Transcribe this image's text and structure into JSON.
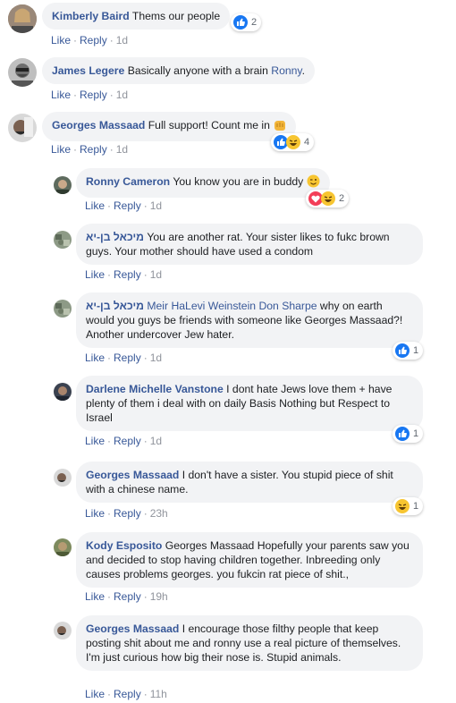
{
  "actions": {
    "like": "Like",
    "reply": "Reply",
    "sep": "·"
  },
  "comments": [
    {
      "author": "Kimberly Baird",
      "text": "Thems our people",
      "time": "1d",
      "reactions": {
        "icons": [
          "like"
        ],
        "count": "2"
      }
    },
    {
      "author": "James Legere",
      "text": "Basically anyone with a brain ",
      "mention": "Ronny",
      "after": ".",
      "time": "1d"
    },
    {
      "author": "Georges Massaad",
      "text": "Full support! Count me in ",
      "time": "1d",
      "reactions": {
        "icons": [
          "like",
          "haha"
        ],
        "count": "4"
      }
    },
    {
      "author": "Ronny Cameron",
      "text": "You know you are in buddy ",
      "time": "1d",
      "reactions": {
        "icons": [
          "love",
          "haha"
        ],
        "count": "2"
      }
    },
    {
      "author": "מיכאל בן-יא",
      "text": "You are another rat. Your sister likes to fukc brown guys. Your mother should have used a condom",
      "time": "1d"
    },
    {
      "author": "מיכאל בן-יא",
      "mention": "Meir HaLevi Weinstein Don Sharpe",
      "text": " why on earth would you guys be friends with someone like Georges Massaad?! Another undercover Jew hater.",
      "time": "1d",
      "reactions": {
        "icons": [
          "like"
        ],
        "count": "1"
      }
    },
    {
      "author": "Darlene Michelle Vanstone",
      "text": "I dont hate Jews love them + have plenty of them i deal with on daily Basis Nothing but Respect to Israel",
      "time": "1d",
      "reactions": {
        "icons": [
          "like"
        ],
        "count": "1"
      }
    },
    {
      "author": "Georges Massaad",
      "text": "I don't have a sister. You stupid piece of shit with a chinese name.",
      "time": "23h",
      "reactions": {
        "icons": [
          "haha"
        ],
        "count": "1"
      }
    },
    {
      "author": "Kody Esposito",
      "text": "Georges Massaad Hopefully your parents saw you and decided to stop having children together. Inbreeding only causes problems georges. you fukcin rat piece of shit.,",
      "time": "19h"
    },
    {
      "author": "Georges Massaad",
      "text": "I encourage those filthy people that keep posting shit about me and ronny use a real picture of themselves. I'm just curious how big their nose is. Stupid animals.",
      "time": "11h"
    }
  ],
  "colors": {
    "link": "#385898",
    "bubble": "#f2f3f5",
    "meta": "#90949c",
    "like": "#1877f2",
    "haha": "#f7c531",
    "love": "#f33e58"
  }
}
